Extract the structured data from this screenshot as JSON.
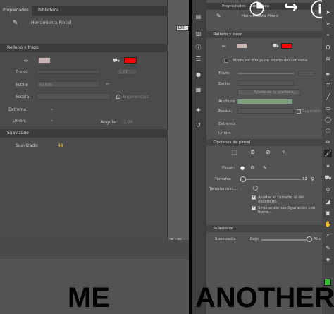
{
  "me": {
    "tabs": [
      "Propiedades",
      "Biblioteca"
    ],
    "tool_name": "Herramienta Pincel",
    "section_fill": "Relleno y trazo",
    "label_stroke": "Trazo:",
    "stroke_value": "1,00",
    "label_style": "Estilo:",
    "style_value": "Sólido",
    "label_scale": "Escala:",
    "hints_label": "Sugerencias",
    "label_cap": "Extremo:",
    "label_join": "Unión:",
    "label_angular": "Angular:",
    "angular_value": "3,00",
    "section_smooth": "Suavizado",
    "label_smoothing": "Suavizado:",
    "smoothing_value": "48",
    "stage_field_value": "100",
    "timeline_numbers": "25   |   30",
    "caption": "ME"
  },
  "another": {
    "tabs": [
      "Propiedades",
      "Biblioteca"
    ],
    "tool_name": "Herramienta Pincel",
    "section_fill": "Relleno y trazo",
    "object_mode": "Modo de dibujo de objeto desactivado",
    "label_stroke": "Trazo:",
    "label_style": "Estilo:",
    "width_adjust": "Ajuste de la anchura...",
    "label_width": "Anchura:",
    "label_scale": "Escala:",
    "hints_label": "Sugerencias",
    "label_cap": "Extremo:",
    "label_join": "Unión:",
    "section_brush": "Opciones de pincel",
    "label_brush": "Pincel:",
    "label_size": "Tamaño:",
    "size_value": "32",
    "label_min_size": "Tamaño mín...:",
    "check_adjust": "Ajustar el tamaño al del escenario",
    "check_sync": "Sincronizar configuración con Borra...",
    "section_smooth": "Suavizado",
    "label_smoothing": "Suavizado:",
    "low": "Bajo",
    "high": "Alto",
    "caption": "ANOTHER"
  },
  "colors": {
    "fill": "#ff0000",
    "accent": "#e7c43a",
    "green": "#2fbf2f"
  }
}
